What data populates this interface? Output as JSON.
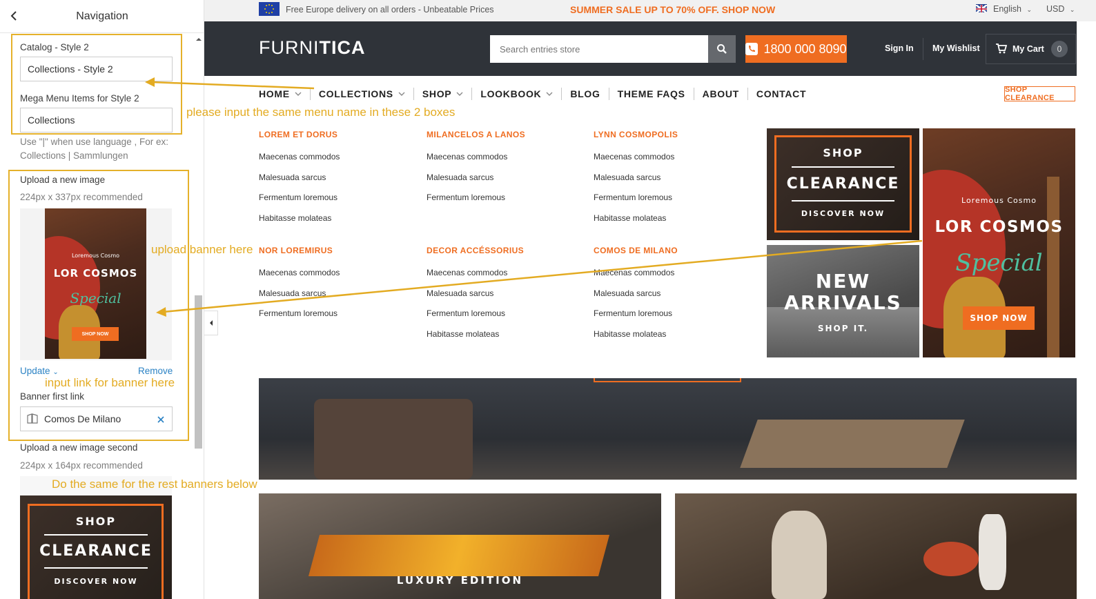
{
  "panel": {
    "title": "Navigation",
    "catalog_label": "Catalog - Style 2",
    "catalog_value": "Collections - Style 2",
    "mega_label": "Mega Menu Items for Style 2",
    "mega_value": "Collections",
    "help_line1": "Use \"|\" when use language , For ex:",
    "help_line2": "Collections | Sammlungen",
    "upload_label": "Upload a new image",
    "upload_hint": "224px x 337px recommended",
    "update_label": "Update",
    "remove_label": "Remove",
    "banner_link_label": "Banner first link",
    "banner_link_value": "Comos De Milano",
    "upload2_label": "Upload a new image second",
    "upload2_hint": "224px x 164px recommended"
  },
  "annotations": {
    "note_menu": "please input the same menu name in these 2 boxes",
    "note_upload": "upload banner here",
    "note_link": "input link for banner here",
    "note_rest": "Do the same for the rest banners below",
    "color": "#e3ab22"
  },
  "topbar": {
    "delivery": "Free Europe delivery on all orders - Unbeatable Prices",
    "sale": "SUMMER SALE UP TO 70% OFF. SHOP NOW",
    "language": "English",
    "currency": "USD"
  },
  "header": {
    "logo_a": "FURNI",
    "logo_b": "TICA",
    "search_placeholder": "Search entries store",
    "phone": "1800 000 8090",
    "sign_in": "Sign In",
    "wishlist": "My Wishlist",
    "cart": "My Cart",
    "cart_count": "0"
  },
  "nav": {
    "items": [
      {
        "label": "HOME",
        "dropdown": true
      },
      {
        "label": "COLLECTIONS",
        "dropdown": true
      },
      {
        "label": "SHOP",
        "dropdown": true
      },
      {
        "label": "LOOKBOOK",
        "dropdown": true
      },
      {
        "label": "BLOG",
        "dropdown": false
      },
      {
        "label": "THEME FAQS",
        "dropdown": false
      },
      {
        "label": "ABOUT",
        "dropdown": false
      },
      {
        "label": "CONTACT",
        "dropdown": false
      }
    ],
    "shop_clearance": "SHOP CLEARANCE"
  },
  "mega": {
    "columns": [
      {
        "title": "LOREM ET DORUS",
        "items": [
          "Maecenas commodos",
          "Malesuada sarcus",
          "Fermentum loremous",
          "Habitasse molateas"
        ]
      },
      {
        "title": "MILANCELOS A LANOS",
        "items": [
          "Maecenas commodos",
          "Malesuada sarcus",
          "Fermentum loremous"
        ]
      },
      {
        "title": "LYNN COSMOPOLIS",
        "items": [
          "Maecenas commodos",
          "Malesuada sarcus",
          "Fermentum loremous",
          "Habitasse molateas"
        ]
      },
      {
        "title": "NOR LOREMIRUS",
        "items": [
          "Maecenas commodos",
          "Malesuada sarcus",
          "Fermentum loremous"
        ]
      },
      {
        "title": "DECOR ACCÉSSORIUS",
        "items": [
          "Maecenas commodos",
          "Malesuada sarcus",
          "Fermentum loremous",
          "Habitasse molateas"
        ]
      },
      {
        "title": "COMOS DE MILANO",
        "items": [
          "Maecenas commodos",
          "Malesuada sarcus",
          "Fermentum loremous",
          "Habitasse molateas"
        ]
      }
    ]
  },
  "banners": {
    "clearance": {
      "shop": "SHOP",
      "title": "CLEARANCE",
      "cta": "DISCOVER NOW"
    },
    "arrivals": {
      "line1": "NEW",
      "line2": "ARRIVALS",
      "cta": "SHOP IT."
    },
    "cosmos": {
      "kicker": "Loremous Cosmo",
      "title": "LOR COSMOS",
      "script": "Special",
      "cta": "SHOP NOW"
    },
    "luxury": "LUXURY EDITION"
  },
  "colors": {
    "accent": "#ef6d21",
    "header_bg": "#2f3339",
    "note": "#e3ab22"
  }
}
